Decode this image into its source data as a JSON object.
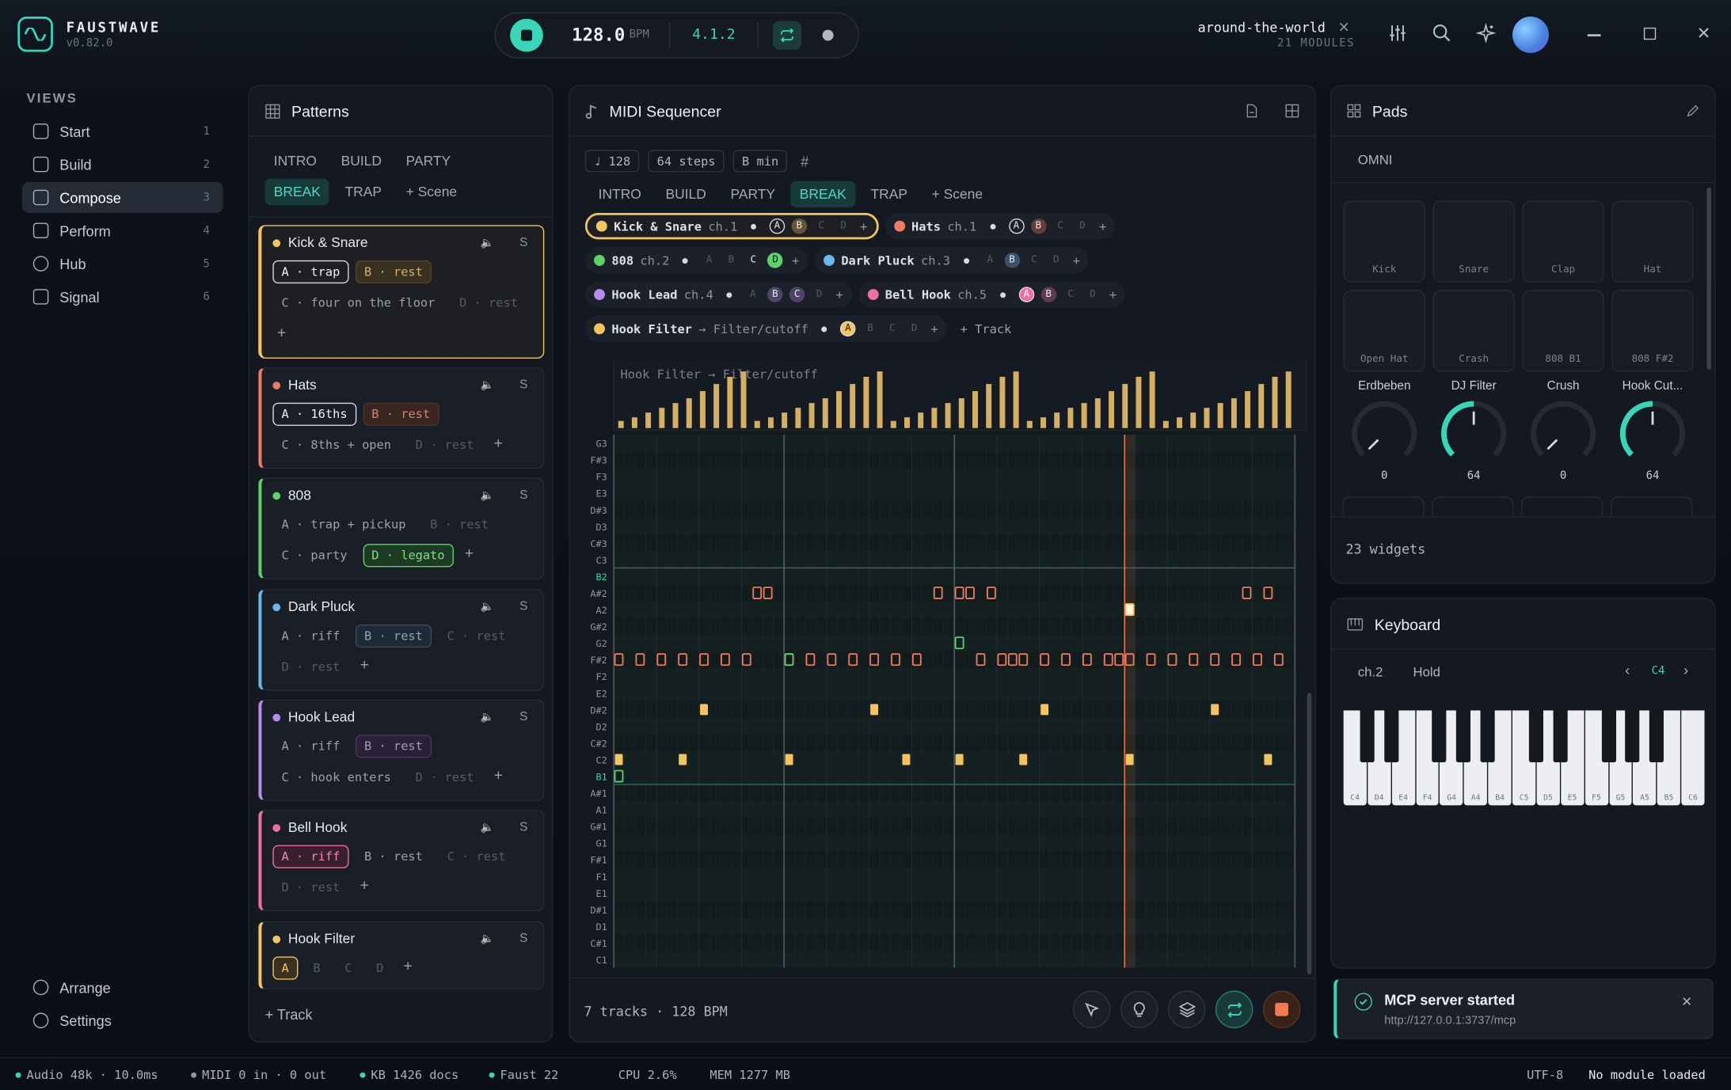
{
  "app": {
    "name": "FAUSTWAVE",
    "version": "v0.82.0"
  },
  "transport": {
    "bpm": "128.0",
    "bpm_unit": "BPM",
    "position": "4.1.2"
  },
  "project": {
    "name": "around-the-world",
    "modules": "21 MODULES"
  },
  "sidebar": {
    "heading": "VIEWS",
    "items": [
      {
        "label": "Start",
        "n": "1"
      },
      {
        "label": "Build",
        "n": "2"
      },
      {
        "label": "Compose",
        "n": "3"
      },
      {
        "label": "Perform",
        "n": "4"
      },
      {
        "label": "Hub",
        "n": "5"
      },
      {
        "label": "Signal",
        "n": "6"
      }
    ],
    "bottom": [
      {
        "label": "Arrange"
      },
      {
        "label": "Settings"
      }
    ]
  },
  "patterns": {
    "title": "Patterns",
    "scenes": [
      "INTRO",
      "BUILD",
      "PARTY",
      "BREAK",
      "TRAP"
    ],
    "active_scene": "BREAK",
    "add_scene": "+ Scene",
    "add_track": "+ Track",
    "cards": [
      {
        "name": "Kick & Snare",
        "color": "#f2c462",
        "mute": "🔈",
        "solo": "S",
        "rows": [
          [
            {
              "t": "A · trap",
              "s": "on"
            },
            {
              "t": "B · rest",
              "s": "warm"
            }
          ],
          [
            {
              "t": "C · four on the floor",
              "s": "plain"
            },
            {
              "t": "D · rest",
              "s": "dim"
            }
          ]
        ],
        "plus_own_row": true
      },
      {
        "name": "Hats",
        "color": "#f07b64",
        "mute": "🔈",
        "solo": "S",
        "rows": [
          [
            {
              "t": "A · 16ths",
              "s": "on"
            },
            {
              "t": "B · rest",
              "s": "warm2"
            }
          ],
          [
            {
              "t": "C · 8ths + open",
              "s": "plain"
            },
            {
              "t": "D · rest",
              "s": "dim"
            },
            {
              "t": "+",
              "s": "plus"
            }
          ]
        ]
      },
      {
        "name": "808",
        "color": "#5fd16a",
        "mute": "🔈",
        "solo": "S",
        "rows": [
          [
            {
              "t": "A · trap + pickup",
              "s": "plain"
            },
            {
              "t": "B · rest",
              "s": "dim"
            }
          ],
          [
            {
              "t": "C · party",
              "s": "plain"
            },
            {
              "t": "D · legato",
              "s": "green"
            },
            {
              "t": "+",
              "s": "plus"
            }
          ]
        ]
      },
      {
        "name": "Dark Pluck",
        "color": "#6fb6ee",
        "mute": "🔈",
        "solo": "S",
        "rows": [
          [
            {
              "t": "A · riff",
              "s": "plain"
            },
            {
              "t": "B · rest",
              "s": "bluebox"
            },
            {
              "t": "C · rest",
              "s": "dim"
            }
          ],
          [
            {
              "t": "D · rest",
              "s": "dim"
            },
            {
              "t": "+",
              "s": "plus"
            }
          ]
        ]
      },
      {
        "name": "Hook Lead",
        "color": "#b98bea",
        "mute": "🔈",
        "solo": "S",
        "rows": [
          [
            {
              "t": "A · riff",
              "s": "plain"
            },
            {
              "t": "B · rest",
              "s": "purplebox"
            }
          ],
          [
            {
              "t": "C · hook enters",
              "s": "plain"
            },
            {
              "t": "D · rest",
              "s": "dim"
            },
            {
              "t": "+",
              "s": "plus"
            }
          ]
        ]
      },
      {
        "name": "Bell Hook",
        "color": "#ef6fa0",
        "mute": "🔈",
        "solo": "S",
        "rows": [
          [
            {
              "t": "A · riff",
              "s": "pink"
            },
            {
              "t": "B · rest",
              "s": "plain"
            },
            {
              "t": "C · rest",
              "s": "dim"
            }
          ],
          [
            {
              "t": "D · rest",
              "s": "dim"
            },
            {
              "t": "+",
              "s": "plus"
            }
          ]
        ]
      },
      {
        "name": "Hook Filter",
        "color": "#f2c462",
        "mute": "🔈",
        "solo": "S",
        "rows": [
          [
            {
              "t": "A",
              "s": "yellowbox"
            },
            {
              "t": "B",
              "s": "dim"
            },
            {
              "t": "C",
              "s": "dim"
            },
            {
              "t": "D",
              "s": "dim"
            },
            {
              "t": "+",
              "s": "plus"
            }
          ]
        ]
      }
    ]
  },
  "sequencer": {
    "title": "MIDI Sequencer",
    "chips": [
      "♩ 128",
      "64 steps",
      "B min",
      "#"
    ],
    "scenes": [
      "INTRO",
      "BUILD",
      "PARTY",
      "BREAK",
      "TRAP"
    ],
    "active_scene": "BREAK",
    "add_scene": "+ Scene",
    "add_track": "+ Track",
    "tracks": [
      {
        "name": "Kick & Snare",
        "ch": "ch.1",
        "color": "#f2c462",
        "slots": [
          "A",
          "B",
          "C",
          "D"
        ],
        "on": [
          0,
          1
        ],
        "selected": true
      },
      {
        "name": "Hats",
        "ch": "ch.1",
        "color": "#f07b64",
        "slots": [
          "A",
          "B",
          "C",
          "D"
        ],
        "on": [
          0,
          1
        ]
      },
      {
        "name": "808",
        "ch": "ch.2",
        "color": "#5fd16a",
        "slots": [
          "A",
          "B",
          "C",
          "D"
        ],
        "on": [
          2,
          3
        ]
      },
      {
        "name": "Dark Pluck",
        "ch": "ch.3",
        "color": "#6fb6ee",
        "slots": [
          "A",
          "B",
          "C",
          "D"
        ],
        "on": [
          1
        ]
      },
      {
        "name": "Hook Lead",
        "ch": "ch.4",
        "color": "#b98bea",
        "slots": [
          "A",
          "B",
          "C",
          "D"
        ],
        "on": [
          1,
          2
        ]
      },
      {
        "name": "Bell Hook",
        "ch": "ch.5",
        "color": "#ef6fa0",
        "slots": [
          "A",
          "B",
          "C",
          "D"
        ],
        "on": [
          0,
          1
        ]
      },
      {
        "name": "Hook Filter",
        "ch": "→ Filter/cutoff",
        "color": "#f2c462",
        "slots": [
          "A",
          "B",
          "C",
          "D"
        ],
        "on": [
          0
        ]
      }
    ],
    "automation_label": "Hook Filter → Filter/cutoff",
    "automation_values": [
      0.12,
      0.18,
      0.26,
      0.34,
      0.42,
      0.5,
      0.62,
      0.74,
      0.86,
      0.95,
      0.12,
      0.18,
      0.26,
      0.34,
      0.42,
      0.5,
      0.62,
      0.74,
      0.86,
      0.95,
      0.12,
      0.18,
      0.26,
      0.34,
      0.42,
      0.5,
      0.62,
      0.74,
      0.86,
      0.95,
      0.12,
      0.18,
      0.26,
      0.34,
      0.42,
      0.5,
      0.62,
      0.74,
      0.86,
      0.95,
      0.12,
      0.18,
      0.26,
      0.34,
      0.42,
      0.5,
      0.62,
      0.74,
      0.86,
      0.95
    ],
    "notes_rows": [
      "G3",
      "F#3",
      "F3",
      "E3",
      "D#3",
      "D3",
      "C#3",
      "C3",
      "B2",
      "A#2",
      "A2",
      "G#2",
      "G2",
      "F#2",
      "F2",
      "E2",
      "D#2",
      "D2",
      "C#2",
      "C2",
      "B1",
      "A#1",
      "A1",
      "G#1",
      "G1",
      "F#1",
      "F1",
      "E1",
      "D#1",
      "D1",
      "C#1",
      "C1"
    ],
    "notes": [
      {
        "row": "F#2",
        "steps": [
          0,
          2,
          4,
          6,
          8,
          10,
          12,
          16,
          18,
          20,
          22,
          24,
          26,
          28,
          34,
          36,
          37,
          38,
          40,
          42,
          44,
          46,
          47,
          48,
          50,
          52,
          54,
          56,
          58,
          60,
          62
        ],
        "kind": "hat"
      },
      {
        "row": "A#2",
        "steps": [
          13,
          14,
          30,
          32,
          33,
          35,
          59,
          61
        ],
        "kind": "hat"
      },
      {
        "row": "A2",
        "steps": [
          48
        ],
        "kind": "cursor"
      },
      {
        "row": "D#2",
        "steps": [
          8,
          24,
          40,
          56
        ],
        "kind": "snare"
      },
      {
        "row": "C2",
        "steps": [
          0,
          6,
          16,
          27,
          32,
          38,
          48,
          61
        ],
        "kind": "kick"
      },
      {
        "row": "G2",
        "steps": [
          32
        ],
        "kind": "green"
      },
      {
        "row": "F#2",
        "steps": [
          16
        ],
        "kind": "green"
      },
      {
        "row": "B1",
        "steps": [
          0
        ],
        "kind": "green"
      }
    ],
    "footer": "7 tracks · 128 BPM"
  },
  "pads": {
    "title": "Pads",
    "mode": "OMNI",
    "pads": [
      "Kick",
      "Snare",
      "Clap",
      "Hat",
      "Open Hat",
      "Crash",
      "808 B1",
      "808 F#2"
    ],
    "knobs": [
      {
        "label": "Erdbeben",
        "value": "0",
        "amount": 0
      },
      {
        "label": "DJ Filter",
        "value": "64",
        "amount": 0.5
      },
      {
        "label": "Crush",
        "value": "0",
        "amount": 0
      },
      {
        "label": "Hook Cut...",
        "value": "64",
        "amount": 0.5
      }
    ],
    "widgets": "23 widgets"
  },
  "keyboard": {
    "title": "Keyboard",
    "channel": "ch.2",
    "hold": "Hold",
    "octave": "C4",
    "labels": [
      "C4",
      "D4",
      "E4",
      "F4",
      "G4",
      "A4",
      "B4",
      "C5",
      "D5",
      "E5",
      "F5",
      "G5",
      "A5",
      "B5",
      "C6"
    ]
  },
  "toast": {
    "title": "MCP server started",
    "url": "http://127.0.0.1:3737/mcp"
  },
  "status": {
    "audio": "Audio 48k · 10.0ms",
    "midi": "MIDI 0 in · 0 out",
    "kb": "KB 1426 docs",
    "faust": "Faust 22",
    "cpu": "CPU 2.6%",
    "mem": "MEM 1277 MB",
    "encoding": "UTF-8",
    "module": "No module loaded"
  },
  "colors": {
    "accent": "#3ad4b8",
    "kick": "#f2c462",
    "hat": "#f07b64"
  }
}
